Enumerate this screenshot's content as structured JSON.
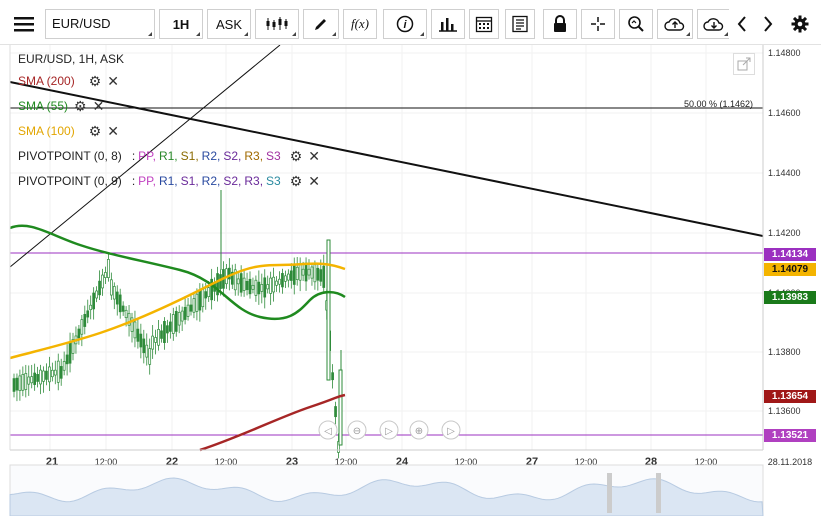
{
  "toolbar": {
    "symbol": "EUR/USD",
    "timeframe": "1H",
    "price_type": "ASK",
    "fx_label": "f(x)",
    "info_label": "i"
  },
  "legend": {
    "title": "EUR/USD, 1H, ASK",
    "sma200": "SMA (200)",
    "sma55": "SMA (55)",
    "sma100": "SMA (100)",
    "pivot1_name": "PIVOTPOINT (0, 8)",
    "pivot2_name": "PIVOTPOINT (0, 9)",
    "pivot_sep": ":",
    "pivot_items": [
      "PP,",
      "R1,",
      "S1,",
      "R2,",
      "S2,",
      "R3,",
      "S3"
    ],
    "pivot_colors1": [
      "#c040c0",
      "#2a8a2a",
      "#8a6a00",
      "#2a4aa0",
      "#6a2a9a",
      "#a06a00",
      "#a030a0"
    ],
    "pivot_colors2": [
      "#c040c0",
      "#2a4aa0",
      "#6a2a9a",
      "#2a4aa0",
      "#6a2a9a",
      "#6a2a9a",
      "#2a8aa0"
    ]
  },
  "fib_label": "50.00 % (1.1462)",
  "price_axis": {
    "ticks": [
      "1.14800",
      "1.14600",
      "1.14400",
      "1.14200",
      "1.14000",
      "1.13800",
      "1.13600"
    ],
    "tags": [
      {
        "value": "1.14134",
        "color": "#9b30c0"
      },
      {
        "value": "1.14079",
        "color": "#f4b400"
      },
      {
        "value": "1.13983",
        "color": "#1a7a1a"
      },
      {
        "value": "1.13654",
        "color": "#a01818"
      },
      {
        "value": "1.13521",
        "color": "#b040c0"
      }
    ]
  },
  "time_axis": {
    "labels": [
      "21",
      "12:00",
      "22",
      "12:00",
      "23",
      "12:00",
      "24",
      "12:00",
      "27",
      "12:00",
      "28",
      "12:00",
      "28.11.2018"
    ]
  },
  "colors": {
    "sma200": "#a62626",
    "sma55": "#1f8a1f",
    "sma100": "#f4b400",
    "pivot": "#9b30c0",
    "candle": "#2e8b3a"
  }
}
